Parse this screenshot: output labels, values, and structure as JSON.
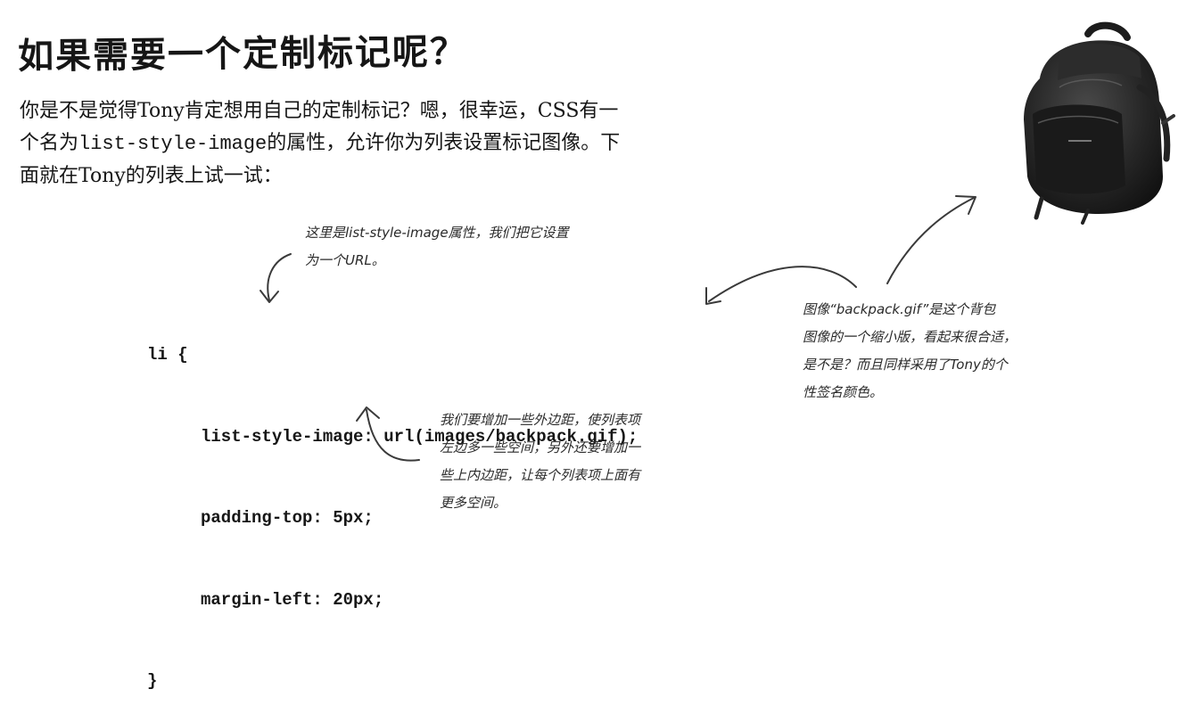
{
  "heading": "如果需要一个定制标记呢？",
  "intro": {
    "part1": "你是不是觉得Tony肯定想用自己的定制标记？嗯，很幸运，CSS有一个名为",
    "code": "list-style-image",
    "part2": "的属性，允许你为列表设置标记图像。下面就在Tony的列表上试一试："
  },
  "code": {
    "line1": "li {",
    "line2": "list-style-image: url(images/backpack.gif);",
    "line3": "padding-top: 5px;",
    "line4": "margin-left: 20px;",
    "line5": "}"
  },
  "notes": {
    "top": [
      "这里是list-style-image属性，我们把它设置",
      "为一个URL。"
    ],
    "right": [
      "图像“backpack.gif”是这个背包",
      "图像的一个缩小版，看起来很合适，",
      "是不是？而且同样采用了Tony的个",
      "性签名颜色。"
    ],
    "bottom": [
      "我们要增加一些外边距，使列表项",
      "左边多一些空间，另外还要增加一",
      "些上内边距，让每个列表项上面有",
      "更多空间。"
    ]
  },
  "icons": {
    "backpack": "backpack-photo"
  }
}
